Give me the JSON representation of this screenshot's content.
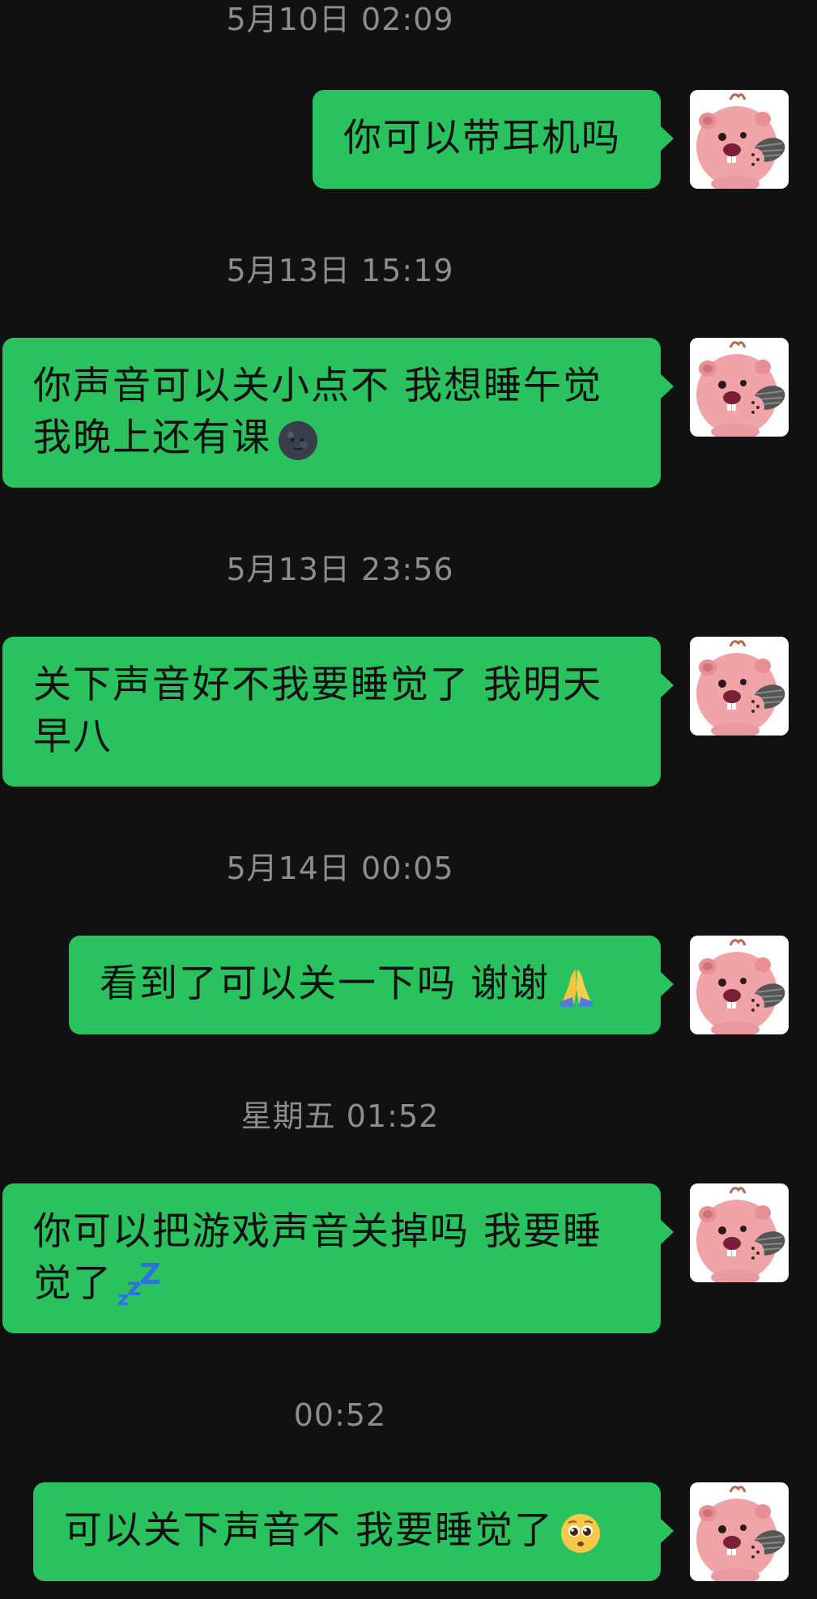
{
  "chat": {
    "messages": [
      {
        "timestamp": "5月10日 02:09",
        "lines": [
          "你可以带耳机吗"
        ],
        "emoji": ""
      },
      {
        "timestamp": "5月13日 15:19",
        "lines": [
          "你声音可以关小点不 我想睡午觉",
          "我晚上还有课"
        ],
        "emoji": "new-moon-face-emoji"
      },
      {
        "timestamp": "5月13日 23:56",
        "lines": [
          "关下声音好不我要睡觉了 我明天",
          "早八"
        ],
        "emoji": ""
      },
      {
        "timestamp": "5月14日 00:05",
        "lines": [
          "看到了可以关一下吗 谢谢"
        ],
        "emoji": "folded-hands-emoji"
      },
      {
        "timestamp": "星期五 01:52",
        "lines": [
          "你可以把游戏声音关掉吗 我要睡",
          "觉了"
        ],
        "emoji": "zzz-emoji"
      },
      {
        "timestamp": "00:52",
        "lines": [
          "可以关下声音不 我要睡觉了"
        ],
        "emoji": "pleading-face-emoji"
      }
    ],
    "avatar_icon": "pink-beaver-avatar",
    "colors": {
      "background": "#111111",
      "bubble": "#29c25f",
      "timestamp": "#8d8d8d",
      "text": "#101010"
    }
  }
}
